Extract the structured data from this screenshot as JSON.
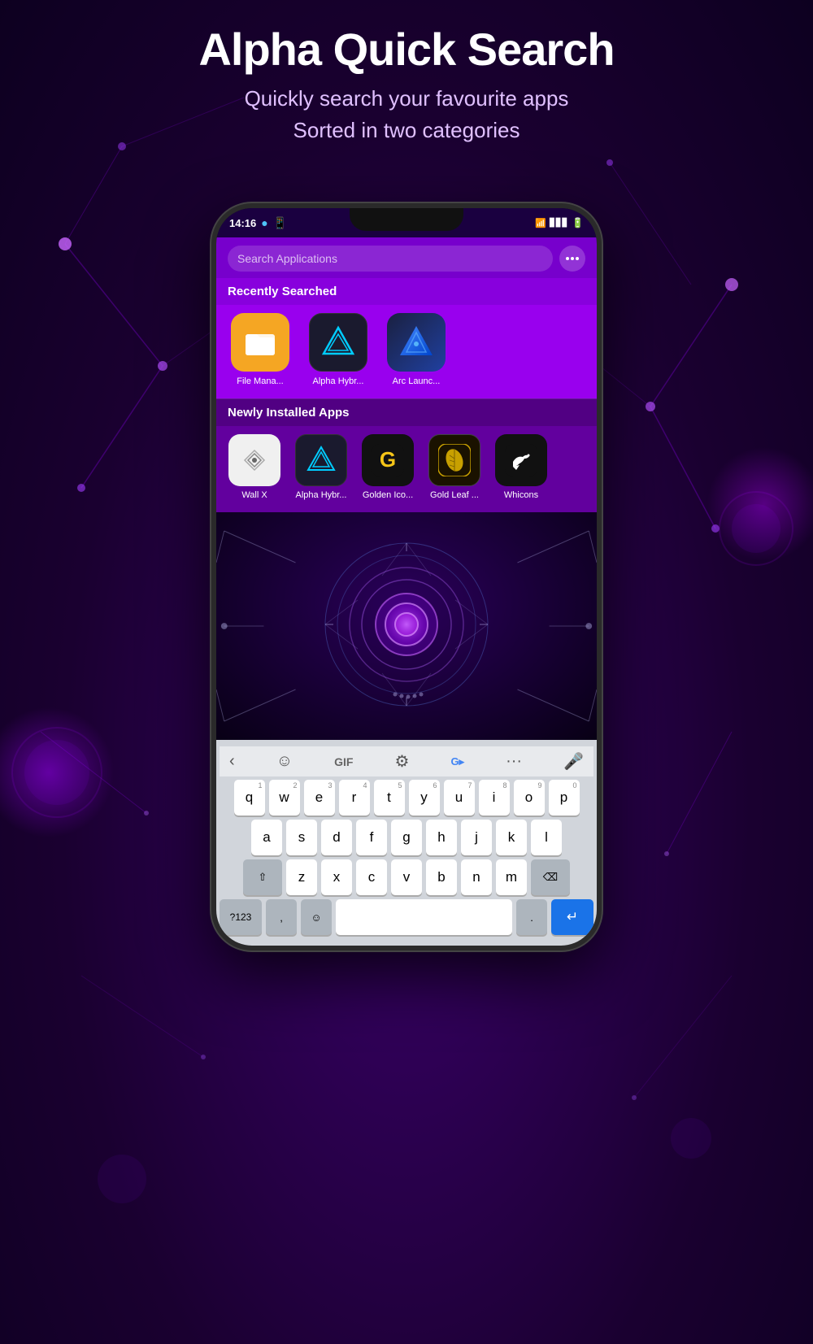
{
  "background": {
    "color": "#1a0030"
  },
  "header": {
    "title": "Alpha Quick Search",
    "subtitle_line1": "Quickly search your favourite apps",
    "subtitle_line2": "Sorted in two categories"
  },
  "phone": {
    "status_bar": {
      "time": "14:16",
      "left_icons": [
        "notification-dot",
        "whatsapp-icon"
      ],
      "right_icons": [
        "wifi-icon",
        "signal-icon",
        "battery-icon"
      ]
    },
    "search_bar": {
      "title": "Search Applications",
      "placeholder": "Search..."
    },
    "recently_searched": {
      "section_title": "Recently Searched",
      "apps": [
        {
          "name": "File Mana...",
          "icon_type": "filemanager",
          "color": "#f5a623"
        },
        {
          "name": "Alpha Hybr...",
          "icon_type": "alphahybrid",
          "color": "#1a1a2e"
        },
        {
          "name": "Arc Launc...",
          "icon_type": "arclauncher",
          "color": "#1a2040"
        }
      ]
    },
    "newly_installed": {
      "section_title": "Newly Installed Apps",
      "apps": [
        {
          "name": "Wall X",
          "icon_type": "wallx",
          "color": "#f0f0f0"
        },
        {
          "name": "Alpha Hybr...",
          "icon_type": "alphahybrid2",
          "color": "#1a1a2e"
        },
        {
          "name": "Golden Ico...",
          "icon_type": "golden",
          "color": "#111"
        },
        {
          "name": "Gold Leaf ...",
          "icon_type": "goldleaf",
          "color": "#111"
        },
        {
          "name": "Whicons",
          "icon_type": "whicons",
          "color": "#1a1a1a"
        }
      ]
    },
    "keyboard": {
      "toolbar": {
        "back": "‹",
        "emoji_keyboard": "☺",
        "gif": "GIF",
        "settings": "⚙",
        "translate": "G▸",
        "more": "···",
        "mic": "🎤"
      },
      "rows": [
        {
          "keys": [
            {
              "label": "q",
              "num": "1"
            },
            {
              "label": "w",
              "num": "2"
            },
            {
              "label": "e",
              "num": "3"
            },
            {
              "label": "r",
              "num": "4"
            },
            {
              "label": "t",
              "num": "5"
            },
            {
              "label": "y",
              "num": "6"
            },
            {
              "label": "u",
              "num": "7"
            },
            {
              "label": "i",
              "num": "8"
            },
            {
              "label": "o",
              "num": "9"
            },
            {
              "label": "p",
              "num": "0"
            }
          ]
        },
        {
          "keys": [
            {
              "label": "a"
            },
            {
              "label": "s"
            },
            {
              "label": "d"
            },
            {
              "label": "f"
            },
            {
              "label": "g"
            },
            {
              "label": "h"
            },
            {
              "label": "j"
            },
            {
              "label": "k"
            },
            {
              "label": "l"
            }
          ]
        },
        {
          "keys_special": true,
          "shift": "⇧",
          "letters": [
            "z",
            "x",
            "c",
            "v",
            "b",
            "n",
            "m"
          ],
          "backspace": "⌫"
        },
        {
          "keys_bottom": true,
          "num_label": "?123",
          "comma": ",",
          "emoji": "☺",
          "space": "",
          "period": ".",
          "enter": "↵"
        }
      ]
    }
  }
}
